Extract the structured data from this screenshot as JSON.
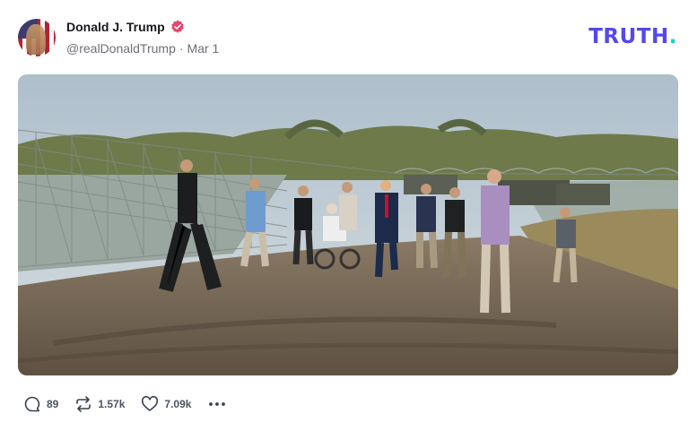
{
  "post": {
    "author": {
      "display_name": "Donald J. Trump",
      "handle": "@realDonaldTrump",
      "verified": true,
      "avatar_icon": "american-flag-portrait"
    },
    "separator": "·",
    "date": "Mar 1",
    "brand": {
      "name": "TRUTH",
      "dot": ".",
      "color": "#5448ee",
      "dot_color": "#18d2c5"
    },
    "media": {
      "kind": "photo",
      "scene": "group of men walking on a dirt road beside razor wire fence along a river"
    },
    "actions": {
      "replies": {
        "count": "89",
        "icon": "comment-icon"
      },
      "retruths": {
        "count": "1.57k",
        "icon": "retruth-icon"
      },
      "likes": {
        "count": "7.09k",
        "icon": "heart-icon"
      },
      "more": {
        "icon": "more-icon"
      }
    }
  },
  "colors": {
    "verified_badge": "#e8456b",
    "muted_text": "#6b6f76"
  }
}
